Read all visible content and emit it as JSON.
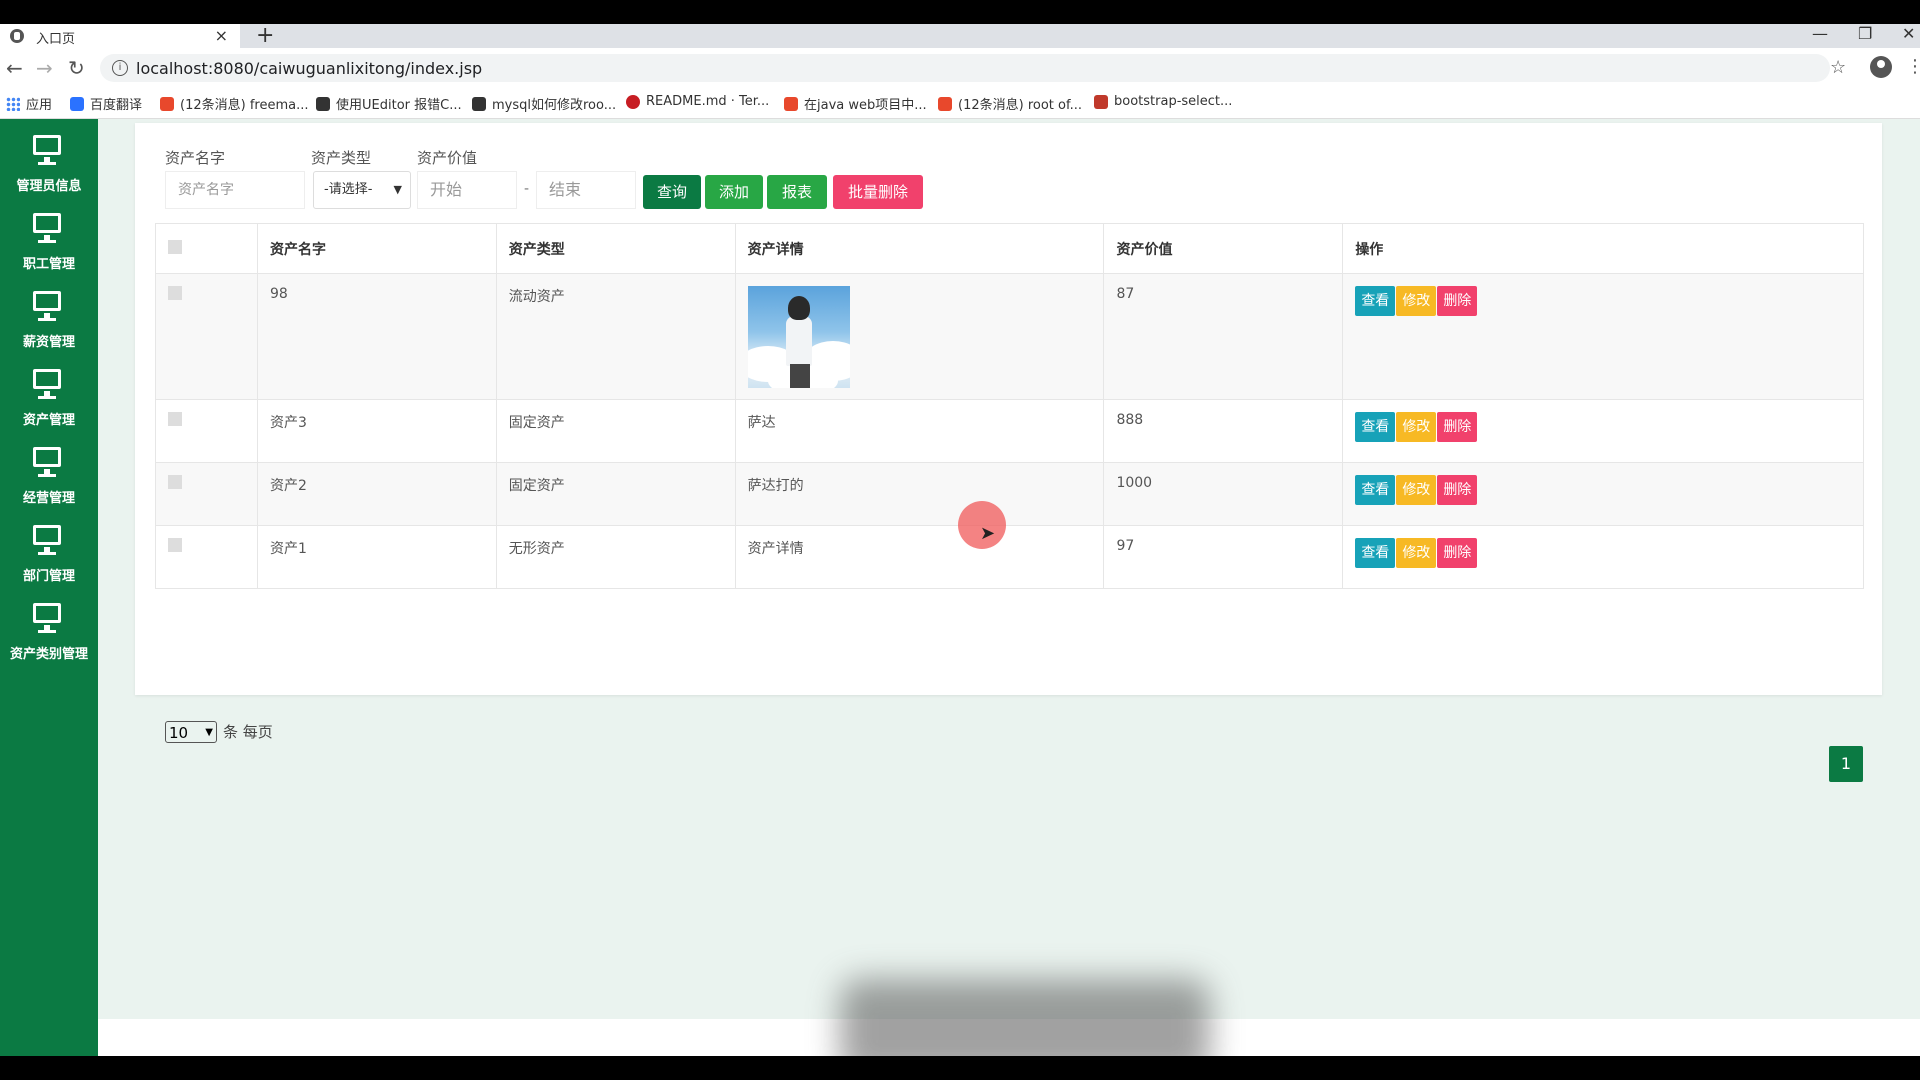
{
  "browser": {
    "tab_title": "入口页",
    "tab_close": "×",
    "new_tab": "+",
    "url": "localhost:8080/caiwuguanlixitong/index.jsp",
    "url_info": "i",
    "bookmarks": [
      {
        "label": "应用",
        "color": "#4285f4"
      },
      {
        "label": "百度翻译",
        "color": "#2b72ff"
      },
      {
        "label": "(12条消息) freema...",
        "color": "#e8482c"
      },
      {
        "label": "使用UEditor 报错C...",
        "color": "#333333"
      },
      {
        "label": "mysql如何修改roo...",
        "color": "#333333"
      },
      {
        "label": "README.md · Ter...",
        "color": "#c71d23"
      },
      {
        "label": "在java web项目中...",
        "color": "#e8482c"
      },
      {
        "label": "(12条消息) root of...",
        "color": "#e8482c"
      },
      {
        "label": "bootstrap-select...",
        "color": "#c0392b"
      }
    ]
  },
  "sidebar": {
    "items": [
      {
        "label": "管理员信息"
      },
      {
        "label": "职工管理"
      },
      {
        "label": "薪资管理"
      },
      {
        "label": "资产管理"
      },
      {
        "label": "经营管理"
      },
      {
        "label": "部门管理"
      },
      {
        "label": "资产类别管理"
      }
    ]
  },
  "filters": {
    "name_label": "资产名字",
    "name_placeholder": "资产名字",
    "type_label": "资产类型",
    "type_value": "-请选择-",
    "value_label": "资产价值",
    "start_placeholder": "开始",
    "range_dash": "-",
    "end_placeholder": "结束",
    "buttons": {
      "search": "查询",
      "add": "添加",
      "report": "报表",
      "batch_delete": "批量删除"
    }
  },
  "table": {
    "headers": [
      "资产名字",
      "资产类型",
      "资产详情",
      "资产价值",
      "操作"
    ],
    "rows": [
      {
        "name": "98",
        "type": "流动资产",
        "detail": "",
        "detail_is_image": true,
        "value": "87"
      },
      {
        "name": "资产3",
        "type": "固定资产",
        "detail": "萨达",
        "value": "888"
      },
      {
        "name": "资产2",
        "type": "固定资产",
        "detail": "萨达打的",
        "value": "1000"
      },
      {
        "name": "资产1",
        "type": "无形资产",
        "detail": "资产详情",
        "value": "97"
      }
    ],
    "actions": {
      "view": "查看",
      "edit": "修改",
      "delete": "删除"
    }
  },
  "pagination": {
    "page_size": "10",
    "per_page_text": "条 每页",
    "current_page": "1"
  },
  "colors": {
    "brand_green": "#0b7a43",
    "add_green": "#28a745",
    "danger": "#f1416c",
    "info": "#17a2b8",
    "warning": "#f7b924"
  }
}
